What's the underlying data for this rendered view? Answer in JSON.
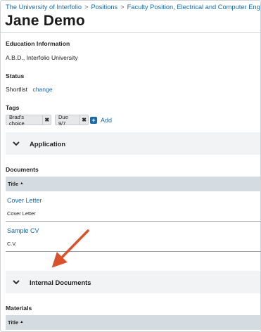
{
  "breadcrumb": {
    "items": [
      "The University of Interfolio",
      "Positions",
      "Faculty Position, Electrical and Computer Engineering"
    ],
    "separator": ">"
  },
  "candidate": {
    "name": "Jane Demo"
  },
  "education": {
    "label": "Education Information",
    "value": "A.B.D., Interfolio University"
  },
  "status": {
    "label": "Status",
    "value": "Shortlist",
    "change_link": "change"
  },
  "tags": {
    "label": "Tags",
    "items": [
      "Brad's choice",
      "Due 9/7"
    ],
    "remove_glyph": "✖",
    "add_label": "Add",
    "add_glyph": "+"
  },
  "sections": {
    "application": "Application",
    "internal_documents": "Internal Documents"
  },
  "documents": {
    "label": "Documents",
    "column_title": "Title",
    "sort_glyph": "▲",
    "rows": [
      {
        "name": "Cover Letter",
        "type": "Cover Letter"
      },
      {
        "name": "Sample CV",
        "type": "C.V."
      }
    ]
  },
  "materials": {
    "label": "Materials",
    "column_title": "Title",
    "sort_glyph": "▲"
  },
  "colors": {
    "link": "#1a6aa8",
    "table_header": "#d4dbe1",
    "section_bg": "#f2f3f4",
    "arrow": "#d9522b"
  },
  "icons": {
    "section_toggle": "chevron-down-icon",
    "tag_remove": "close-icon",
    "add": "plus-square-icon",
    "annotation": "arrow-annotation"
  }
}
